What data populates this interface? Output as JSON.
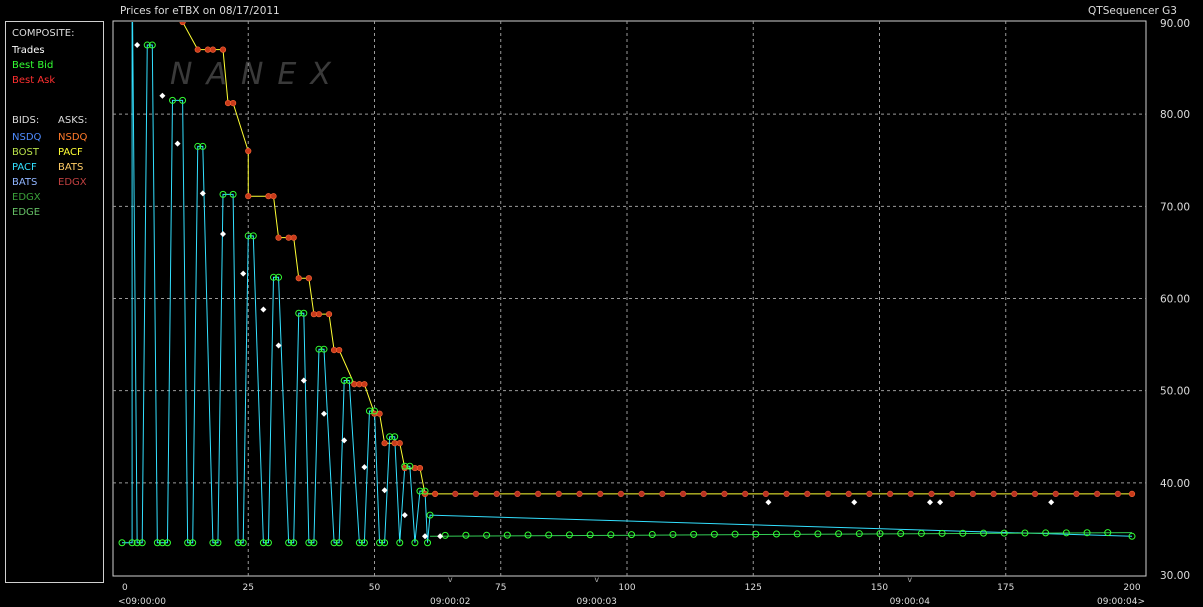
{
  "header": {
    "title": "Prices for  eTBX  on  08/17/2011",
    "brand": "QTSequencer G3",
    "watermark": "NANEX"
  },
  "legend": {
    "composite_label": "COMPOSITE:",
    "composite": [
      {
        "label": "Trades",
        "color": "#ffffff"
      },
      {
        "label": "Best Bid",
        "color": "#33ff33"
      },
      {
        "label": "Best Ask",
        "color": "#ff3030"
      }
    ],
    "bids_label": "BIDS:",
    "asks_label": "ASKS:",
    "bids": [
      {
        "label": "NSDQ",
        "color": "#4f8cff"
      },
      {
        "label": "BOST",
        "color": "#b8e04a"
      },
      {
        "label": "PACF",
        "color": "#33e0ff"
      },
      {
        "label": "BATS",
        "color": "#8fb4ff"
      },
      {
        "label": "EDGX",
        "color": "#3aa03a"
      },
      {
        "label": "EDGE",
        "color": "#66c066"
      }
    ],
    "asks": [
      {
        "label": "NSDQ",
        "color": "#ff7a2a"
      },
      {
        "label": "PACF",
        "color": "#ffff33"
      },
      {
        "label": "BATS",
        "color": "#ffcc66"
      },
      {
        "label": "EDGX",
        "color": "#c04040"
      }
    ]
  },
  "chart_data": {
    "type": "line",
    "ylim": [
      30,
      90
    ],
    "y_ticks": [
      "30.00",
      "40.00",
      "50.00",
      "60.00",
      "70.00",
      "80.00",
      "90.00"
    ],
    "xlim": [
      0,
      200
    ],
    "x_ticks": [
      "0",
      "25",
      "50",
      "75",
      "100",
      "125",
      "150",
      "175",
      "200"
    ],
    "time_labels": [
      {
        "x": 0,
        "label": "<09:00:00"
      },
      {
        "x": 65,
        "label": "09:00:02"
      },
      {
        "x": 94,
        "label": "09:00:03"
      },
      {
        "x": 156,
        "label": "09:00:04"
      },
      {
        "x": 200,
        "label": "09:00:04>"
      }
    ],
    "grid": true,
    "series": [
      {
        "name": "Best Ask",
        "color": "#ffff33",
        "x": [
          0,
          5,
          10,
          12,
          15,
          17,
          18,
          20,
          21,
          22,
          25,
          25,
          29,
          30,
          31,
          33,
          34,
          35,
          37,
          38,
          39,
          41,
          42,
          43,
          46,
          47,
          48,
          50,
          51,
          52,
          54,
          55,
          56,
          58,
          59,
          60,
          62,
          200
        ],
        "y": [
          110,
          102,
          96,
          90,
          87,
          87,
          87,
          87,
          81.2,
          81.2,
          76,
          71.1,
          71.1,
          71.1,
          66.6,
          66.6,
          66.6,
          62.2,
          62.2,
          58.3,
          58.3,
          58.3,
          54.4,
          54.4,
          50.7,
          50.7,
          50.7,
          47.5,
          47.5,
          44.3,
          44.3,
          44.3,
          41.6,
          41.6,
          41.6,
          38.8,
          38.8,
          38.8
        ]
      },
      {
        "name": "Best Bid",
        "color": "#33e0ff",
        "x": [
          0,
          2,
          2,
          3,
          4,
          5,
          6,
          7,
          8,
          9,
          10,
          12,
          13,
          14,
          15,
          16,
          18,
          19,
          20,
          22,
          23,
          24,
          25,
          26,
          28,
          29,
          30,
          31,
          33,
          34,
          35,
          36,
          37,
          38,
          39,
          40,
          42,
          43,
          44,
          45,
          47,
          48,
          49,
          50,
          51,
          52,
          53,
          54,
          55,
          56,
          57,
          58,
          59,
          60,
          60.5,
          61,
          200
        ],
        "y": [
          33.5,
          33.5,
          96,
          33.5,
          33.5,
          87.5,
          87.5,
          33.5,
          33.5,
          33.5,
          81.5,
          81.5,
          33.5,
          33.5,
          76.5,
          76.5,
          33.5,
          33.5,
          71.3,
          71.3,
          33.5,
          33.5,
          66.8,
          66.8,
          33.5,
          33.5,
          62.3,
          62.3,
          33.5,
          33.5,
          58.4,
          58.4,
          33.5,
          33.5,
          54.5,
          54.5,
          33.5,
          33.5,
          51.1,
          51.1,
          33.5,
          33.5,
          47.8,
          47.8,
          33.5,
          33.5,
          45,
          45,
          33.5,
          41.8,
          41.8,
          33.5,
          39.1,
          39.1,
          33.5,
          36.5,
          34.2
        ]
      },
      {
        "name": "Trades",
        "color": "#ffffff",
        "x": [
          3,
          8,
          11,
          16,
          20,
          24,
          28,
          31,
          36,
          40,
          44,
          48,
          52,
          56,
          60,
          63,
          128,
          145,
          160,
          162,
          184
        ],
        "y": [
          87.5,
          82,
          76.8,
          71.4,
          67,
          62.7,
          58.8,
          54.9,
          51.1,
          47.5,
          44.6,
          41.7,
          39.2,
          36.5,
          34.2,
          34.2,
          37.9,
          37.9,
          37.9,
          37.9,
          37.9
        ]
      }
    ]
  }
}
